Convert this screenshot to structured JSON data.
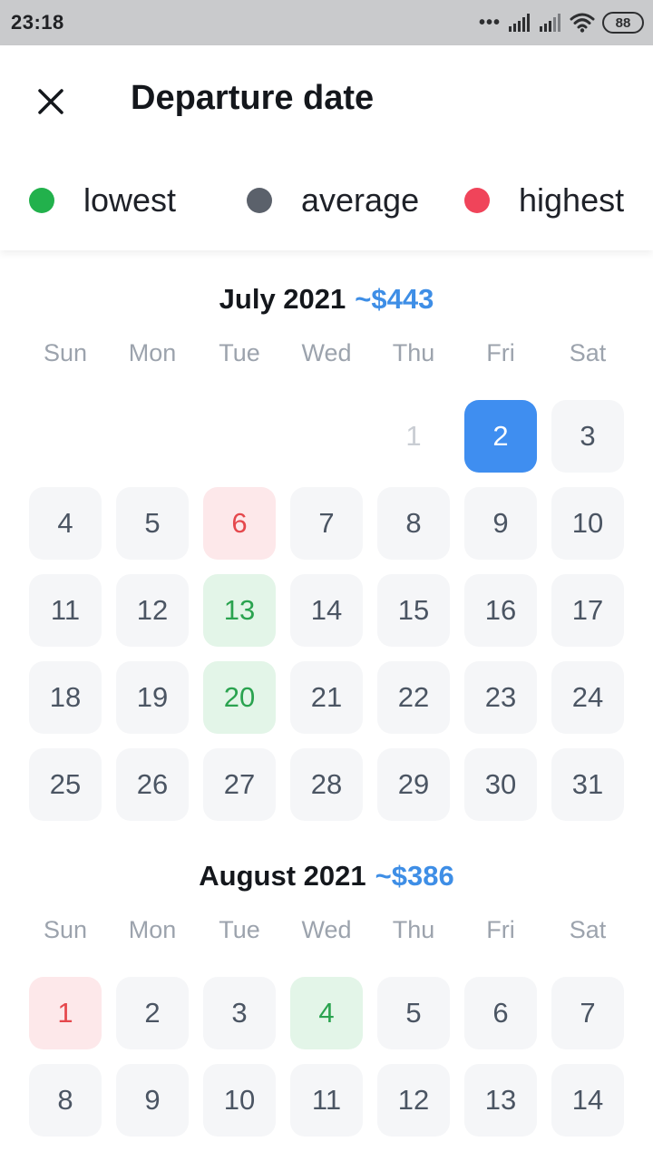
{
  "status_bar": {
    "time": "23:18",
    "battery": "88",
    "icons": [
      "more-dots-icon",
      "signal-icon",
      "signal-icon",
      "wifi-icon",
      "battery-icon"
    ]
  },
  "header": {
    "title": "Departure date",
    "close_icon": "close-icon"
  },
  "legend": [
    {
      "label": "lowest",
      "color": "#22b14c"
    },
    {
      "label": "average",
      "color": "#5b616b"
    },
    {
      "label": "highest",
      "color": "#f0445a"
    }
  ],
  "colors": {
    "accent": "#3f8ef0",
    "price": "#3e8ee6",
    "lowest_bg": "#e3f5e8",
    "lowest_text": "#2aa34f",
    "highest_bg": "#fde8ea",
    "highest_text": "#e5484d"
  },
  "weekdays": [
    "Sun",
    "Mon",
    "Tue",
    "Wed",
    "Thu",
    "Fri",
    "Sat"
  ],
  "months": [
    {
      "title": "July 2021",
      "price": "~$443",
      "first_weekday": 4,
      "days": 31,
      "disabled": [
        1
      ],
      "selected": 2,
      "highest": [
        6
      ],
      "lowest": [
        13,
        20
      ]
    },
    {
      "title": "August 2021",
      "price": "~$386",
      "first_weekday": 0,
      "days": 14,
      "disabled": [],
      "selected": null,
      "highest": [
        1
      ],
      "lowest": [
        4
      ]
    }
  ]
}
